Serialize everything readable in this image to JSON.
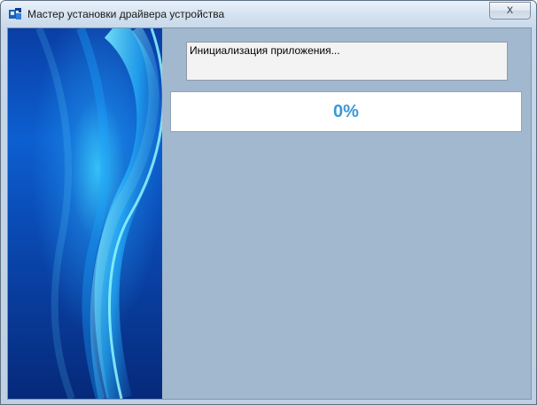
{
  "window": {
    "title": "Мастер установки драйвера устройства",
    "app_icon": "installer-icon",
    "close_label": "x"
  },
  "status": {
    "message": "Инициализация приложения..."
  },
  "progress": {
    "value": 0,
    "label": "0%",
    "text_color": "#3b98d8"
  },
  "banner": {
    "icon": "blue-abstract-banner"
  }
}
